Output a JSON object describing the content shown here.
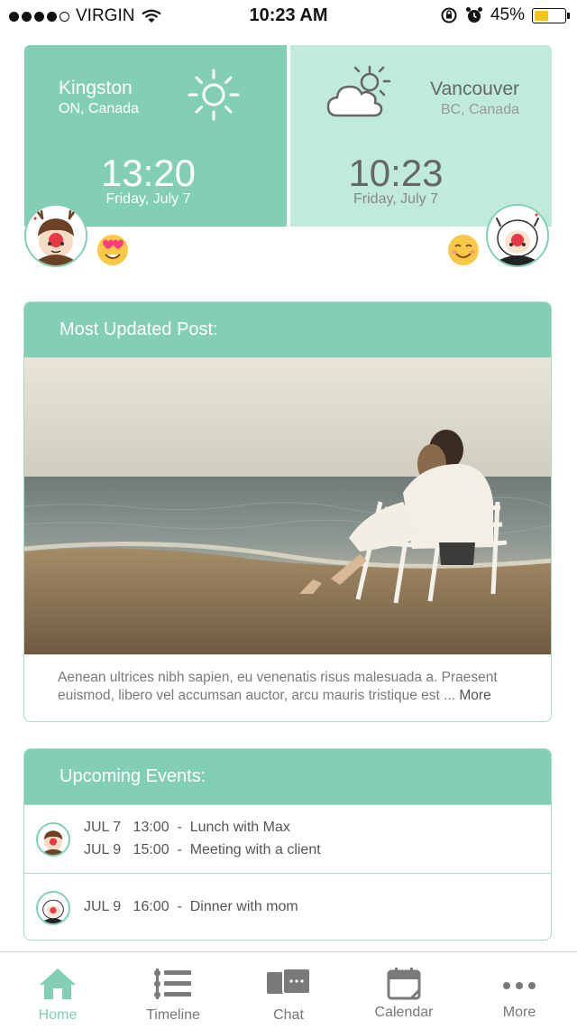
{
  "status_bar": {
    "carrier": "VIRGIN",
    "time": "10:23 AM",
    "battery": "45%",
    "battery_level": 0.45
  },
  "weather": {
    "left": {
      "city": "Kingston",
      "region": "ON, Canada",
      "time": "13:20",
      "date": "Friday, July 7",
      "icon": "sun-icon"
    },
    "right": {
      "city": "Vancouver",
      "region": "BC, Canada",
      "time": "10:23",
      "date": "Friday, July 7",
      "icon": "partly-cloudy-icon"
    }
  },
  "post": {
    "header": "Most Updated Post:",
    "text": "Aenean ultrices nibh sapien, eu venenatis risus malesuada a. Praesent euismod, libero vel accumsan auctor, arcu mauris tristique est ...",
    "more_label": "More"
  },
  "events": {
    "header": "Upcoming Events:",
    "groups": [
      {
        "avatar": "boy-avatar",
        "items": [
          {
            "date": "JUL 7",
            "time": "13:00",
            "title": "Lunch with Max"
          },
          {
            "date": "JUL 9",
            "time": "15:00",
            "title": "Meeting with a client"
          }
        ]
      },
      {
        "avatar": "girl-avatar",
        "items": [
          {
            "date": "JUL 9",
            "time": "16:00",
            "title": "Dinner with mom"
          }
        ]
      }
    ]
  },
  "tabs": [
    {
      "label": "Home",
      "icon": "home-icon",
      "active": true
    },
    {
      "label": "Timeline",
      "icon": "list-icon",
      "active": false
    },
    {
      "label": "Chat",
      "icon": "chat-icon",
      "active": false
    },
    {
      "label": "Calendar",
      "icon": "calendar-icon",
      "active": false
    },
    {
      "label": "More",
      "icon": "more-icon",
      "active": false
    }
  ],
  "colors": {
    "accent": "#82cfb6",
    "accent_light": "#c0eadb",
    "border": "#a7dcc9"
  }
}
